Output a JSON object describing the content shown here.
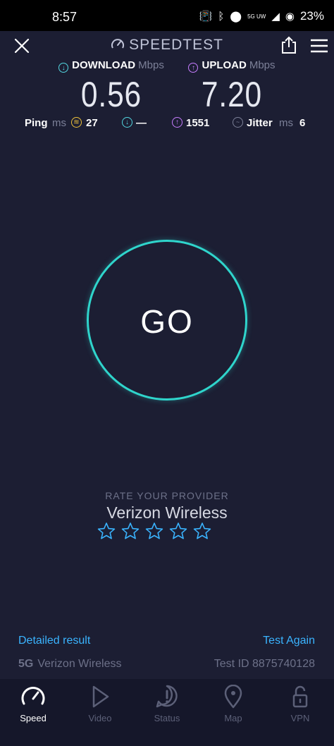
{
  "status_bar": {
    "time": "8:57",
    "signal": "5G UW",
    "battery": "23%"
  },
  "header": {
    "title": "SPEEDTEST"
  },
  "download": {
    "label": "DOWNLOAD",
    "unit": "Mbps",
    "value": "0.56"
  },
  "upload": {
    "label": "UPLOAD",
    "unit": "Mbps",
    "value": "7.20"
  },
  "ping": {
    "label": "Ping",
    "unit": "ms",
    "idle": "27",
    "download": "—",
    "upload": "1551"
  },
  "jitter": {
    "label": "Jitter",
    "unit": "ms",
    "value": "6"
  },
  "go_button": {
    "label": "GO"
  },
  "rating": {
    "title": "RATE YOUR PROVIDER",
    "provider": "Verizon Wireless",
    "stars_total": 5,
    "stars_selected": 0
  },
  "result": {
    "detailed_label": "Detailed result",
    "test_again_label": "Test Again",
    "network": "5G",
    "provider": "Verizon Wireless",
    "test_id": "Test ID 8875740128"
  },
  "tabs": [
    {
      "label": "Speed",
      "icon": "speedometer-icon",
      "active": true
    },
    {
      "label": "Video",
      "icon": "play-icon",
      "active": false
    },
    {
      "label": "Status",
      "icon": "alert-icon",
      "active": false
    },
    {
      "label": "Map",
      "icon": "map-pin-icon",
      "active": false
    },
    {
      "label": "VPN",
      "icon": "lock-icon",
      "active": false
    }
  ],
  "colors": {
    "background": "#1c1e33",
    "accent_teal": "#2fd5cc",
    "download": "#53d6e0",
    "upload": "#c77dff",
    "link": "#3ab4ff",
    "ping_idle": "#f0c23a"
  }
}
